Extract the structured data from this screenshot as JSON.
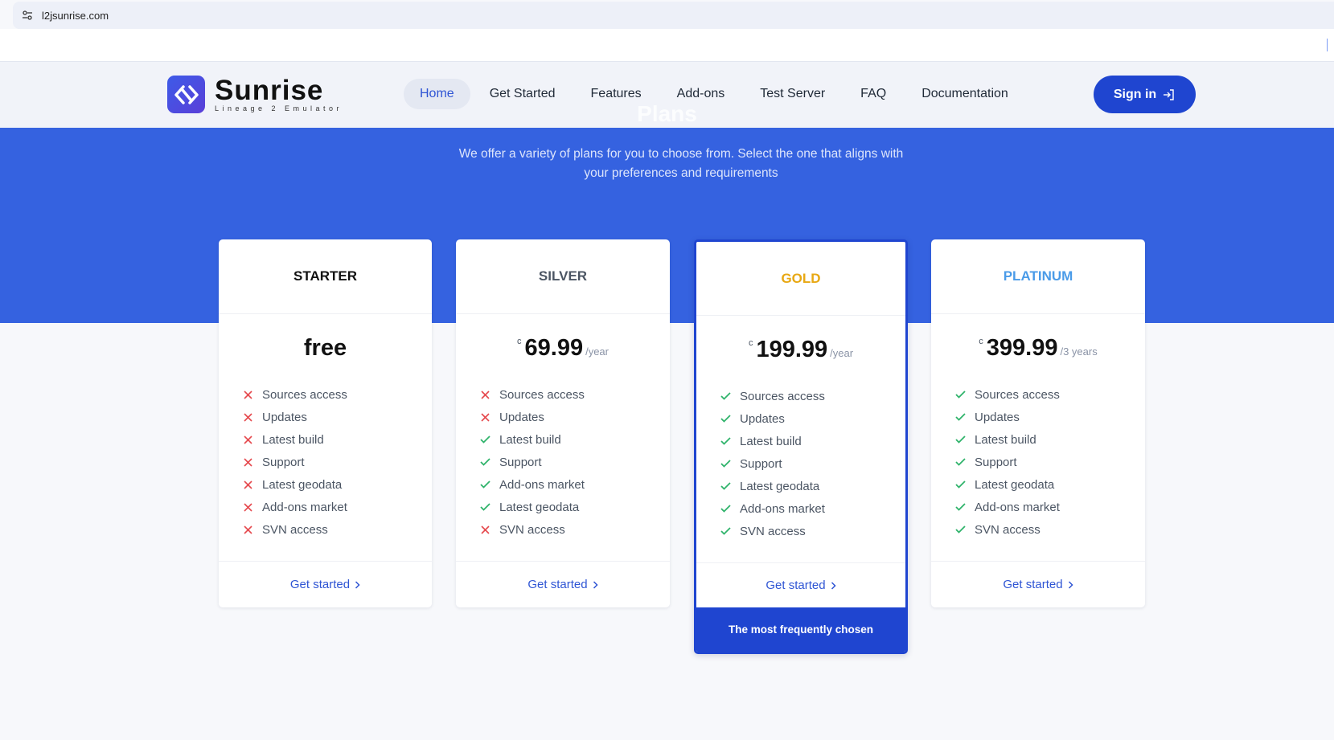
{
  "browser": {
    "url": "l2jsunrise.com"
  },
  "brand": {
    "name": "Sunrise",
    "tagline": "Lineage 2 Emulator",
    "accent": "#1f45d0"
  },
  "nav": {
    "items": [
      {
        "label": "Home",
        "active": true
      },
      {
        "label": "Get Started"
      },
      {
        "label": "Features"
      },
      {
        "label": "Add-ons"
      },
      {
        "label": "Test Server"
      },
      {
        "label": "FAQ"
      },
      {
        "label": "Documentation"
      }
    ],
    "signin_label": "Sign in"
  },
  "hero": {
    "title": "Plans",
    "subtitle": "We offer a variety of plans for you to choose from. Select the one that aligns with your preferences and requirements",
    "background": "#3562e0"
  },
  "plans": [
    {
      "name": "STARTER",
      "name_color": "#111111",
      "price_free": "free",
      "features": [
        {
          "label": "Sources access",
          "included": false
        },
        {
          "label": "Updates",
          "included": false
        },
        {
          "label": "Latest build",
          "included": false
        },
        {
          "label": "Support",
          "included": false
        },
        {
          "label": "Latest geodata",
          "included": false
        },
        {
          "label": "Add-ons market",
          "included": false
        },
        {
          "label": "SVN access",
          "included": false
        }
      ],
      "cta": "Get started"
    },
    {
      "name": "SILVER",
      "name_color": "#4b5563",
      "currency": "c",
      "price": "69.99",
      "period": "/year",
      "features": [
        {
          "label": "Sources access",
          "included": false
        },
        {
          "label": "Updates",
          "included": false
        },
        {
          "label": "Latest build",
          "included": true
        },
        {
          "label": "Support",
          "included": true
        },
        {
          "label": "Add-ons market",
          "included": true
        },
        {
          "label": "Latest geodata",
          "included": true
        },
        {
          "label": "SVN access",
          "included": false
        }
      ],
      "cta": "Get started"
    },
    {
      "name": "GOLD",
      "name_color": "#e8a813",
      "currency": "c",
      "price": "199.99",
      "period": "/year",
      "features": [
        {
          "label": "Sources access",
          "included": true
        },
        {
          "label": "Updates",
          "included": true
        },
        {
          "label": "Latest build",
          "included": true
        },
        {
          "label": "Support",
          "included": true
        },
        {
          "label": "Latest geodata",
          "included": true
        },
        {
          "label": "Add-ons market",
          "included": true
        },
        {
          "label": "SVN access",
          "included": true
        }
      ],
      "cta": "Get started",
      "badge": "The most frequently chosen"
    },
    {
      "name": "PLATINUM",
      "name_color": "#4a9be8",
      "currency": "c",
      "price": "399.99",
      "period": "/3 years",
      "features": [
        {
          "label": "Sources access",
          "included": true
        },
        {
          "label": "Updates",
          "included": true
        },
        {
          "label": "Latest build",
          "included": true
        },
        {
          "label": "Support",
          "included": true
        },
        {
          "label": "Latest geodata",
          "included": true
        },
        {
          "label": "Add-ons market",
          "included": true
        },
        {
          "label": "SVN access",
          "included": true
        }
      ],
      "cta": "Get started"
    }
  ],
  "icons": {
    "included": "check-icon",
    "excluded": "cross-icon",
    "included_color": "#2fb36b",
    "excluded_color": "#e5484d"
  }
}
